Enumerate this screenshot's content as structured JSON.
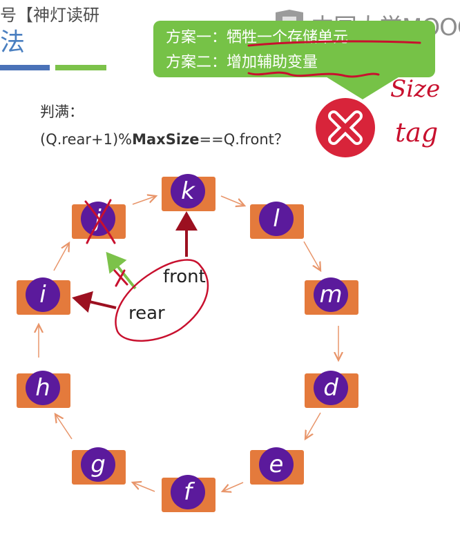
{
  "header": {
    "text": "号【神灯读研",
    "title_fragment": "法"
  },
  "watermark": {
    "text": "中国大学MOOC"
  },
  "callout": {
    "line1": "方案一：牺牲一个存储单元",
    "line2": "方案二：增加辅助变量"
  },
  "condition": {
    "label": "判满：",
    "prefix": "(Q.rear+1)%",
    "bold": "MaxSize",
    "suffix": "==Q.front？"
  },
  "handwriting": {
    "size": "Size",
    "tag": "tag"
  },
  "pointers": {
    "front": "front",
    "rear": "rear"
  },
  "nodes": [
    "k",
    "l",
    "m",
    "d",
    "e",
    "f",
    "g",
    "h",
    "i",
    "j"
  ],
  "colors": {
    "node_box": "#e47a3c",
    "node_circle": "#5b1a9c",
    "callout_bg": "#76c247",
    "badge_red": "#d8243a",
    "ink_red": "#c8102e",
    "arrow_orange": "#e8956a",
    "arrow_green": "#7cc24a",
    "arrow_darkred": "#9c1020"
  },
  "icons": {
    "badge": "x-circle-icon"
  }
}
